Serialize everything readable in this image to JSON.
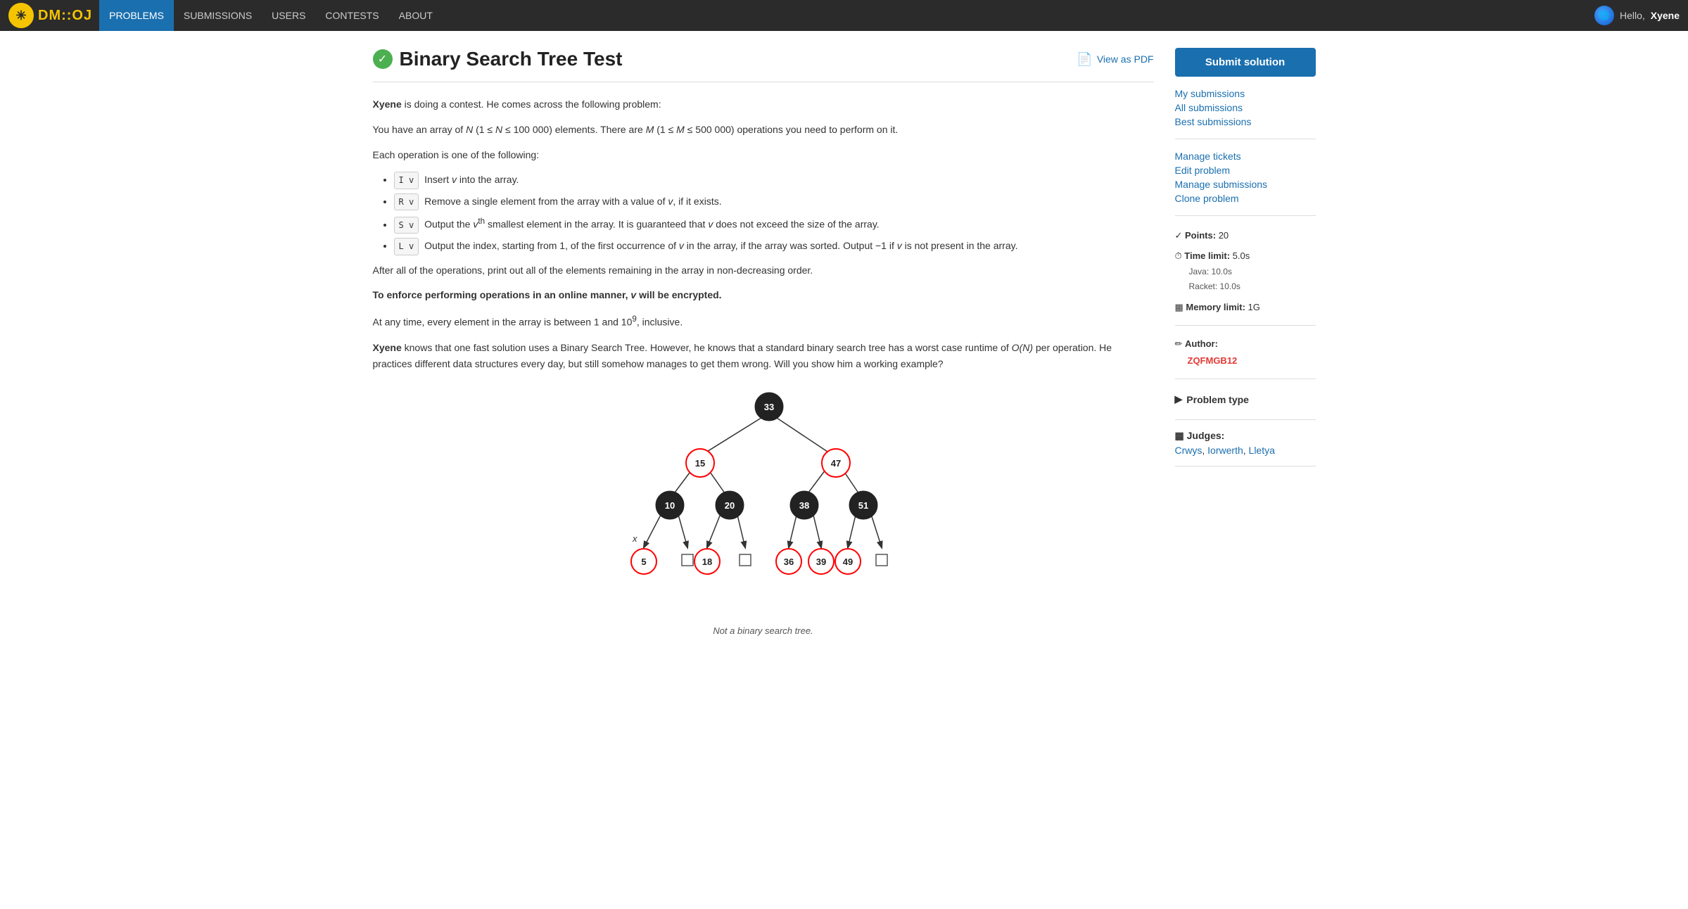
{
  "nav": {
    "logo_symbol": "✳",
    "logo_text": "DM::OJ",
    "links": [
      "PROBLEMS",
      "SUBMISSIONS",
      "USERS",
      "CONTESTS",
      "ABOUT"
    ],
    "active_link": "PROBLEMS",
    "user_greeting": "Hello,",
    "username": "Xyene"
  },
  "problem": {
    "title": "Binary Search Tree Test",
    "has_checkmark": true,
    "view_pdf_label": "View as PDF",
    "body": {
      "intro": "is doing a contest. He comes across the following problem:",
      "actor": "Xyene",
      "para1": "You have an array of N (1 ≤ N ≤ 100 000) elements. There are M (1 ≤ M ≤ 500 000) operations you need to perform on it.",
      "para2": "Each operation is one of the following:",
      "ops": [
        {
          "key": "I v",
          "desc": "Insert v into the array."
        },
        {
          "key": "R v",
          "desc": "Remove a single element from the array with a value of v, if it exists."
        },
        {
          "key": "S v",
          "desc": "Output the v^th smallest element in the array. It is guaranteed that v does not exceed the size of the array."
        },
        {
          "key": "L v",
          "desc": "Output the index, starting from 1, of the first occurrence of v in the array, if the array was sorted. Output −1 if v is not present in the array."
        }
      ],
      "para3": "After all of the operations, print out all of the elements remaining in the array in non-decreasing order.",
      "para4_bold": "To enforce performing operations in an online manner, v will be encrypted.",
      "para5": "At any time, every element in the array is between 1 and 10^9, inclusive.",
      "para6_start": "knows that one fast solution uses a Binary Search Tree. However, he knows that a standard binary search tree has a worst case runtime of O(N) per operation. He practices different data structures every day, but still somehow manages to get them wrong. Will you show him a working example?",
      "para6_actor": "Xyene",
      "diagram_caption": "Not a binary search tree."
    }
  },
  "sidebar": {
    "submit_label": "Submit solution",
    "links": [
      {
        "label": "My submissions",
        "href": "#"
      },
      {
        "label": "All submissions",
        "href": "#"
      },
      {
        "label": "Best submissions",
        "href": "#"
      }
    ],
    "manage_links": [
      {
        "label": "Manage tickets",
        "href": "#"
      },
      {
        "label": "Edit problem",
        "href": "#"
      },
      {
        "label": "Manage submissions",
        "href": "#"
      },
      {
        "label": "Clone problem",
        "href": "#"
      }
    ],
    "points_label": "Points:",
    "points_value": "20",
    "time_limit_label": "Time limit:",
    "time_limit_value": "5.0s",
    "time_java": "Java: 10.0s",
    "time_racket": "Racket: 10.0s",
    "memory_limit_label": "Memory limit:",
    "memory_limit_value": "1G",
    "author_label": "Author:",
    "author_name": "ZQFMGB12",
    "problem_type_label": "Problem type",
    "judges_label": "Judges:",
    "judges": [
      "Crwys",
      "Iorwerth",
      "Lletya"
    ]
  }
}
